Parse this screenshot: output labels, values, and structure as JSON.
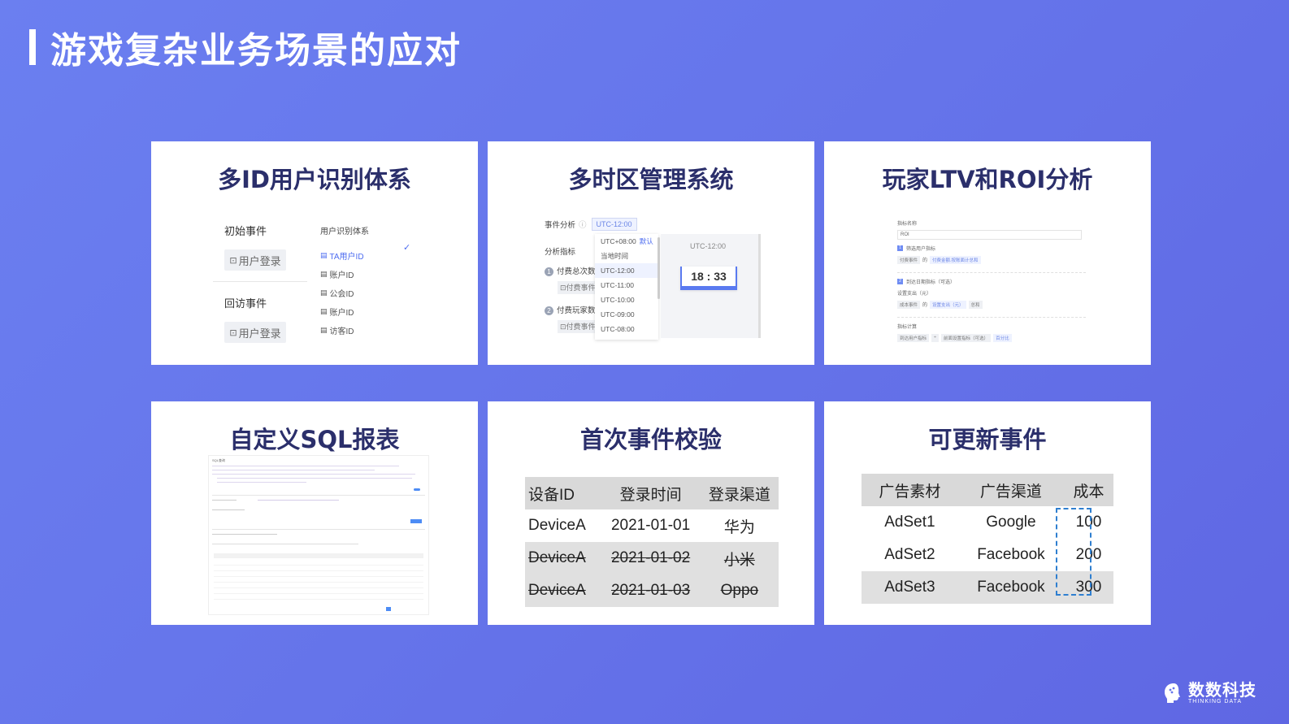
{
  "page": {
    "title": "游戏复杂业务场景的应对"
  },
  "cards": [
    {
      "title": "多ID用户识别体系",
      "initial_event_label": "初始事件",
      "initial_event_button": "用户登录",
      "return_event_label": "回访事件",
      "return_event_button": "用户登录",
      "list_header": "用户识别体系",
      "id_options": [
        "TA用户ID",
        "账户ID",
        "公会ID",
        "账户ID",
        "访客ID"
      ],
      "selected_option": "TA用户ID",
      "check_icon": "check-icon"
    },
    {
      "title": "多时区管理系统",
      "event_analysis_label": "事件分析",
      "timezone_tag": "UTC-12:00",
      "metric_label": "分析指标",
      "metric1": "付费总次数",
      "metric1_pill": "付费事件",
      "metric2": "付费玩家数",
      "metric2_pill": "付费事件",
      "timezone_options": [
        "UTC+08:00",
        "当地时间",
        "UTC-12:00",
        "UTC-11:00",
        "UTC-10:00",
        "UTC-09:00",
        "UTC-08:00"
      ],
      "default_tag": "默认",
      "panel_timezone": "UTC-12:00",
      "clock": "18 : 33"
    },
    {
      "title": "玩家LTV和ROI分析",
      "name_label": "指标名称",
      "name_value": "ROI",
      "step1": "筛选用户指标",
      "step1_chips": [
        "付费事件",
        "的",
        "付费金额.按账面计总和"
      ],
      "step2": "到达日期指标（可选）",
      "cost_label": "设置支出（元）",
      "step2_chips": [
        "成本事件",
        "的",
        "设置支出（元）",
        "总和"
      ],
      "calc_label": "指标计算",
      "calc_chips": [
        "到达用户指标",
        "÷",
        "前面设置指标（可选）",
        "百分比"
      ]
    },
    {
      "title": "自定义SQL报表",
      "panel_title": "SQL查询"
    },
    {
      "title": "首次事件校验",
      "headers": [
        "设备ID",
        "登录时间",
        "登录渠道"
      ],
      "rows": [
        [
          "DeviceA",
          "2021-01-01",
          "华为"
        ],
        [
          "DeviceA",
          "2021-01-02",
          "小米"
        ],
        [
          "DeviceA",
          "2021-01-03",
          "Oppo"
        ]
      ]
    },
    {
      "title": "可更新事件",
      "headers": [
        "广告素材",
        "广告渠道",
        "成本"
      ],
      "rows": [
        [
          "AdSet1",
          "Google",
          "100"
        ],
        [
          "AdSet2",
          "Facebook",
          "200"
        ],
        [
          "AdSet3",
          "Facebook",
          "300"
        ]
      ]
    }
  ],
  "logo": {
    "cn": "数数科技",
    "en": "THINKING DATA",
    "icon": "brain-head-icon"
  }
}
